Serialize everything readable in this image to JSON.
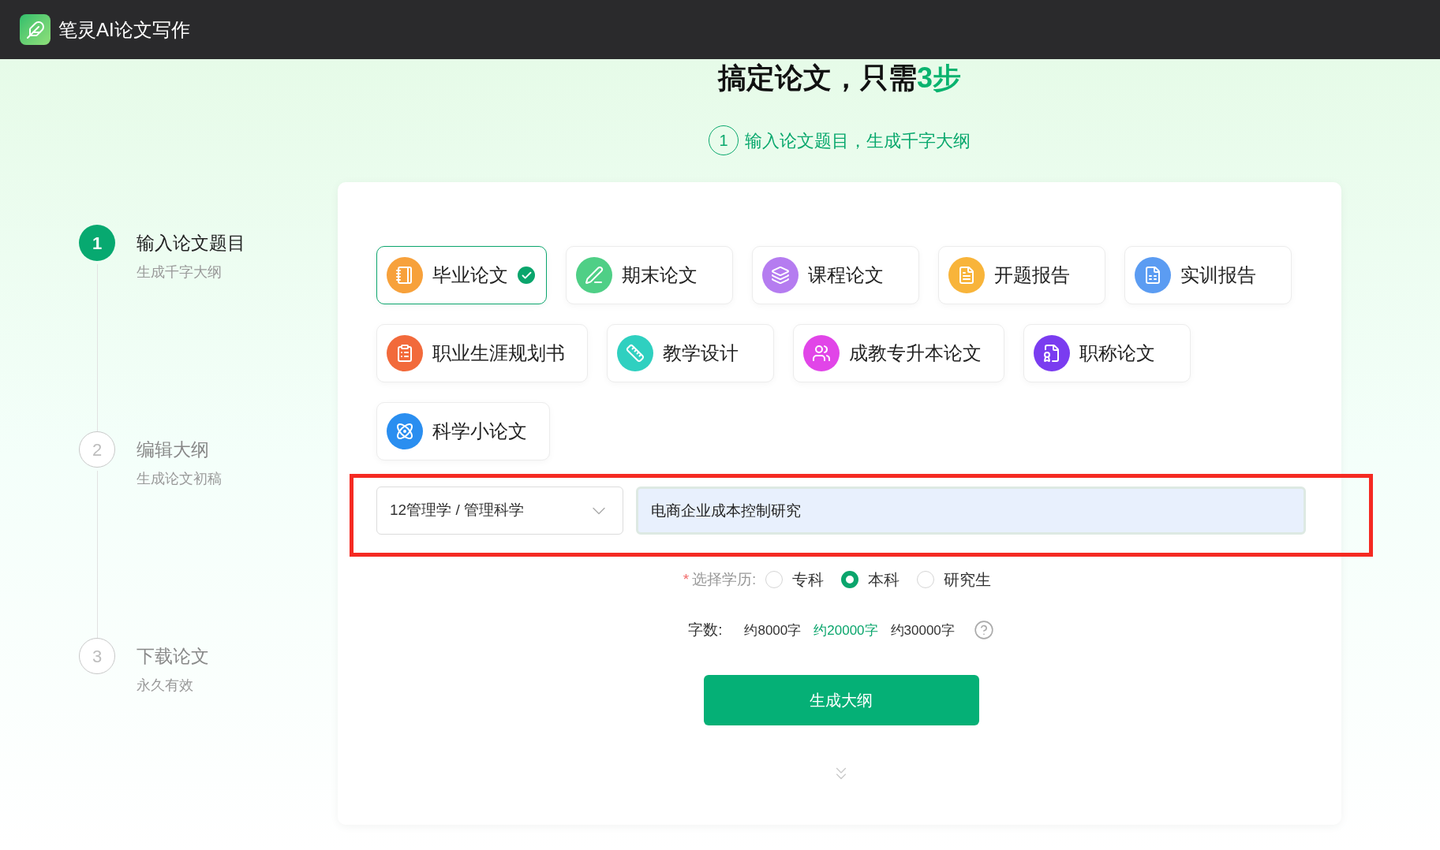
{
  "app": {
    "title": "笔灵AI论文写作"
  },
  "headline": {
    "text": "搞定论文，只需",
    "highlight": "3步"
  },
  "current_step": {
    "number": "1",
    "text": "输入论文题目，生成千字大纲"
  },
  "steps": [
    {
      "number": "1",
      "title": "输入论文题目",
      "subtitle": "生成千字大纲",
      "selected": true
    },
    {
      "number": "2",
      "title": "编辑大纲",
      "subtitle": "生成论文初稿",
      "selected": false
    },
    {
      "number": "3",
      "title": "下载论文",
      "subtitle": "永久有效",
      "selected": false
    }
  ],
  "paper_types": [
    {
      "label": "毕业论文",
      "color": "#f7a13b",
      "selected": true
    },
    {
      "label": "期末论文",
      "color": "#4fcf86",
      "selected": false
    },
    {
      "label": "课程论文",
      "color": "#b57cf0",
      "selected": false
    },
    {
      "label": "开题报告",
      "color": "#f8b43a",
      "selected": false
    },
    {
      "label": "实训报告",
      "color": "#5b9cf2",
      "selected": false
    },
    {
      "label": "职业生涯规划书",
      "color": "#f26a3b",
      "selected": false
    },
    {
      "label": "教学设计",
      "color": "#2fd0c0",
      "selected": false
    },
    {
      "label": "成教专升本论文",
      "color": "#e145e8",
      "selected": false
    },
    {
      "label": "职称论文",
      "color": "#7a3cf0",
      "selected": false
    },
    {
      "label": "科学小论文",
      "color": "#2a8ef0",
      "selected": false
    }
  ],
  "subject_select": {
    "value": "12管理学 / 管理科学"
  },
  "topic_input": {
    "value": "电商企业成本控制研究"
  },
  "education": {
    "label": "选择学历:",
    "required_mark": "*",
    "options": [
      {
        "label": "专科",
        "selected": false
      },
      {
        "label": "本科",
        "selected": true
      },
      {
        "label": "研究生",
        "selected": false
      }
    ]
  },
  "word_count": {
    "label": "字数:",
    "options": [
      {
        "label": "约8000字",
        "selected": false
      },
      {
        "label": "约20000字",
        "selected": true
      },
      {
        "label": "约30000字",
        "selected": false
      }
    ]
  },
  "generate_button": "生成大纲"
}
